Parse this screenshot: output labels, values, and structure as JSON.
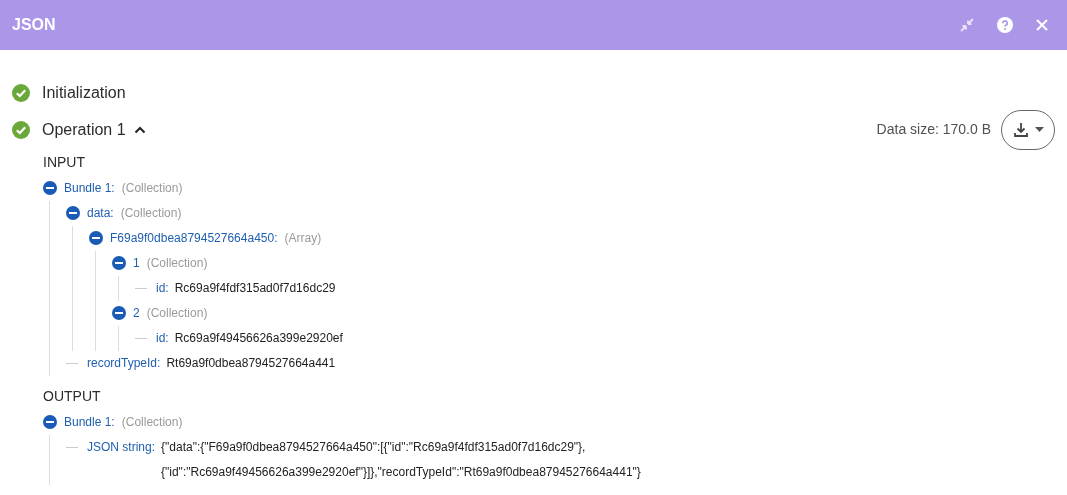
{
  "window": {
    "title": "JSON"
  },
  "steps": [
    {
      "label": "Initialization",
      "done": true,
      "expanded": false
    },
    {
      "label": "Operation 1",
      "done": true,
      "expanded": true
    }
  ],
  "data_size": "Data size: 170.0 B",
  "sections": [
    {
      "heading": "INPUT",
      "tree": [
        {
          "key": "Bundle 1:",
          "type": "(Collection)",
          "expanded": true,
          "children": [
            {
              "key": "data:",
              "type": "(Collection)",
              "expanded": true,
              "children": [
                {
                  "key": "F69a9f0dbea8794527664a450:",
                  "type": "(Array)",
                  "expanded": true,
                  "children": [
                    {
                      "key": "1",
                      "type": "(Collection)",
                      "expanded": true,
                      "children": [
                        {
                          "key": "id:",
                          "value_lines": [
                            "Rc69a9f4fdf315ad0f7d16dc29"
                          ]
                        }
                      ]
                    },
                    {
                      "key": "2",
                      "type": "(Collection)",
                      "expanded": true,
                      "children": [
                        {
                          "key": "id:",
                          "value_lines": [
                            "Rc69a9f49456626a399e2920ef"
                          ]
                        }
                      ]
                    }
                  ]
                }
              ]
            },
            {
              "key": "recordTypeId:",
              "value_lines": [
                "Rt69a9f0dbea8794527664a441"
              ]
            }
          ]
        }
      ]
    },
    {
      "heading": "OUTPUT",
      "tree": [
        {
          "key": "Bundle 1:",
          "type": "(Collection)",
          "expanded": true,
          "children": [
            {
              "key": "JSON string:",
              "value_lines": [
                "{\"data\":{\"F69a9f0dbea8794527664a450\":[{\"id\":\"Rc69a9f4fdf315ad0f7d16dc29\"},",
                "{\"id\":\"Rc69a9f49456626a399e2920ef\"}]},\"recordTypeId\":\"Rt69a9f0dbea8794527664a441\"}"
              ]
            }
          ]
        }
      ]
    }
  ]
}
